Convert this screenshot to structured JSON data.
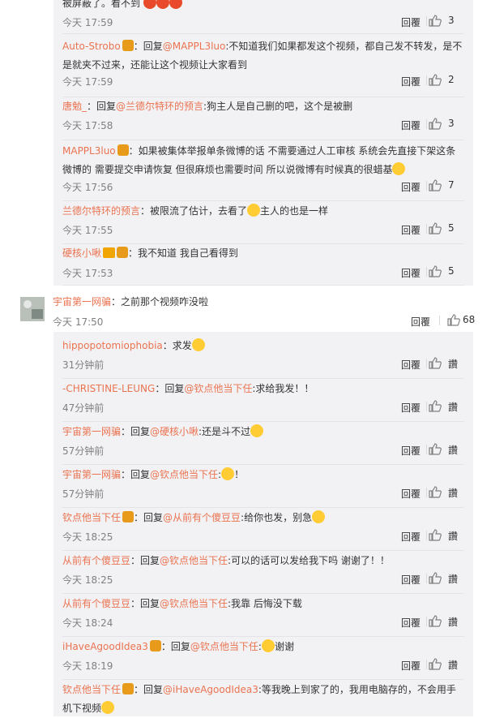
{
  "top_fragment": {
    "text": "被屏蔽了。看不到",
    "time": "今天 17:59",
    "reply": "回覆",
    "likes": "3"
  },
  "replies_group1": [
    {
      "name": "Auto-Strobo",
      "pre": "：回复",
      "at": "@MAPPL3luo",
      "text": ":不知道我们如果都发这个视频，都自己发不转发，是不是就夹不过来，还能让这个视频让大家看到",
      "time": "今天 17:59",
      "reply": "回覆",
      "likes": "2"
    },
    {
      "name": "唐勉_",
      "pre": "：回复",
      "at": "@兰德尔特环的预言",
      "text": ":狗主人是自己删的吧，这个是被删",
      "time": "今天 17:58",
      "reply": "回覆",
      "likes": "3"
    },
    {
      "name": "MAPPL3luo",
      "pre": "",
      "at": "",
      "text": "：如果被集体举报单条微博的话 不需要通过人工审核 系统会先直接下架这条微博的 需要提交申请恢复 但很麻烦也需要时间 所以说微博有时候真的很蜡基",
      "time": "今天 17:56",
      "reply": "回覆",
      "likes": "7"
    },
    {
      "name": "兰德尔特环的预言",
      "pre": "",
      "at": "",
      "text": "：被限流了估计，去看了",
      "text2": "主人的也是一样",
      "time": "今天 17:55",
      "reply": "回覆",
      "likes": "5"
    },
    {
      "name": "硬核小啾",
      "pre": "",
      "at": "",
      "text": "：我不知道 我自己看得到",
      "time": "今天 17:53",
      "reply": "回覆",
      "likes": "5"
    }
  ],
  "main_comment": {
    "name": "宇宙第一网骗",
    "text": "：之前那个视频咋没啦",
    "time": "今天 17:50",
    "reply": "回覆",
    "likes": "68"
  },
  "replies_group2": [
    {
      "name": "hippopotomiophobia",
      "pre": "",
      "at": "",
      "text": "：求发",
      "time": "31分钟前",
      "reply": "回覆",
      "likes": "讚"
    },
    {
      "name": "-CHRISTINE-LEUNG",
      "pre": "：回复",
      "at": "@钦点他当下任",
      "text": ":求给我发！！",
      "time": "47分钟前",
      "reply": "回覆",
      "likes": "讚"
    },
    {
      "name": "宇宙第一网骗",
      "pre": "：回复",
      "at": "@硬核小啾",
      "text": ":还是斗不过",
      "time": "57分钟前",
      "reply": "回覆",
      "likes": "讚"
    },
    {
      "name": "宇宙第一网骗",
      "pre": "：回复",
      "at": "@钦点他当下任",
      "text": ":",
      "text2": "！",
      "time": "57分钟前",
      "reply": "回覆",
      "likes": "讚"
    },
    {
      "name": "钦点他当下任",
      "pre": "：回复",
      "at": "@从前有个傻豆豆",
      "text": ":给你也发，别急",
      "time": "今天 18:25",
      "reply": "回覆",
      "likes": "讚"
    },
    {
      "name": "从前有个傻豆豆",
      "pre": "：回复",
      "at": "@钦点他当下任",
      "text": ":可以的话可以发给我下吗 谢谢了！！",
      "time": "今天 18:25",
      "reply": "回覆",
      "likes": "讚"
    },
    {
      "name": "从前有个傻豆豆",
      "pre": "：回复",
      "at": "@钦点他当下任",
      "text": ":我靠 后悔没下载",
      "time": "今天 18:24",
      "reply": "回覆",
      "likes": "讚"
    },
    {
      "name": "iHaveAgoodIdea3",
      "pre": "：回复",
      "at": "@钦点他当下任",
      "text": ":",
      "text2": "谢谢",
      "time": "今天 18:19",
      "reply": "回覆",
      "likes": "讚"
    },
    {
      "name": "钦点他当下任",
      "pre": "：回复",
      "at": "@iHaveAgoodIdea3",
      "text": ":等我晚上到家了的，我用电脑存的，不会用手机下视频",
      "time": "",
      "reply": "",
      "likes": ""
    }
  ],
  "colors": {
    "link": "#eb7350",
    "panel_bg": "#f2f2f5",
    "time": "#808080",
    "emoji_yellow": "#ffcc33",
    "emoji_red": "#e84a2b",
    "vip_badge": "#f5a623"
  },
  "icons": {
    "like": "thumbs-up-icon",
    "vip": "vip-badge-icon",
    "verified": "verified-v-icon"
  }
}
